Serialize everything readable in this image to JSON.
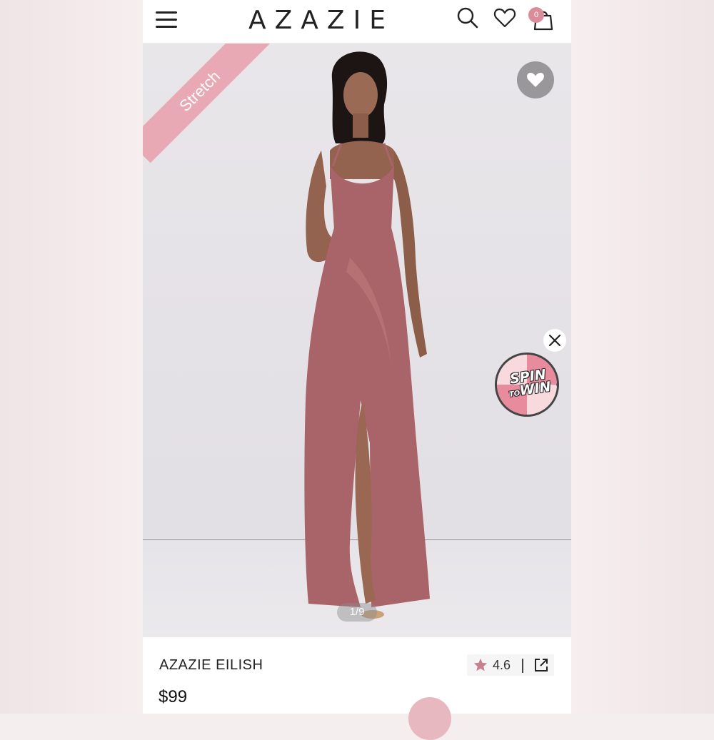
{
  "header": {
    "brand": "AZAZIE",
    "cart_count": "0",
    "icons": [
      "menu-icon",
      "search-icon",
      "heart-icon",
      "cart-icon"
    ]
  },
  "gallery": {
    "badge": "Stretch",
    "counter": "1/9",
    "favorite_icon": "heart-icon",
    "dress_color": "#a86468"
  },
  "promo": {
    "spin_line1": "SPIN",
    "spin_line2": "TO",
    "spin_line3": "WIN",
    "close_icon": "close-icon"
  },
  "product": {
    "name": "AZAZIE EILISH",
    "price": "$99",
    "rating": "4.6",
    "share_icon": "share-external-icon"
  },
  "colors": {
    "accent": "#d98d9b",
    "ribbon": "#e9a9b4",
    "star": "#c97f8d"
  }
}
